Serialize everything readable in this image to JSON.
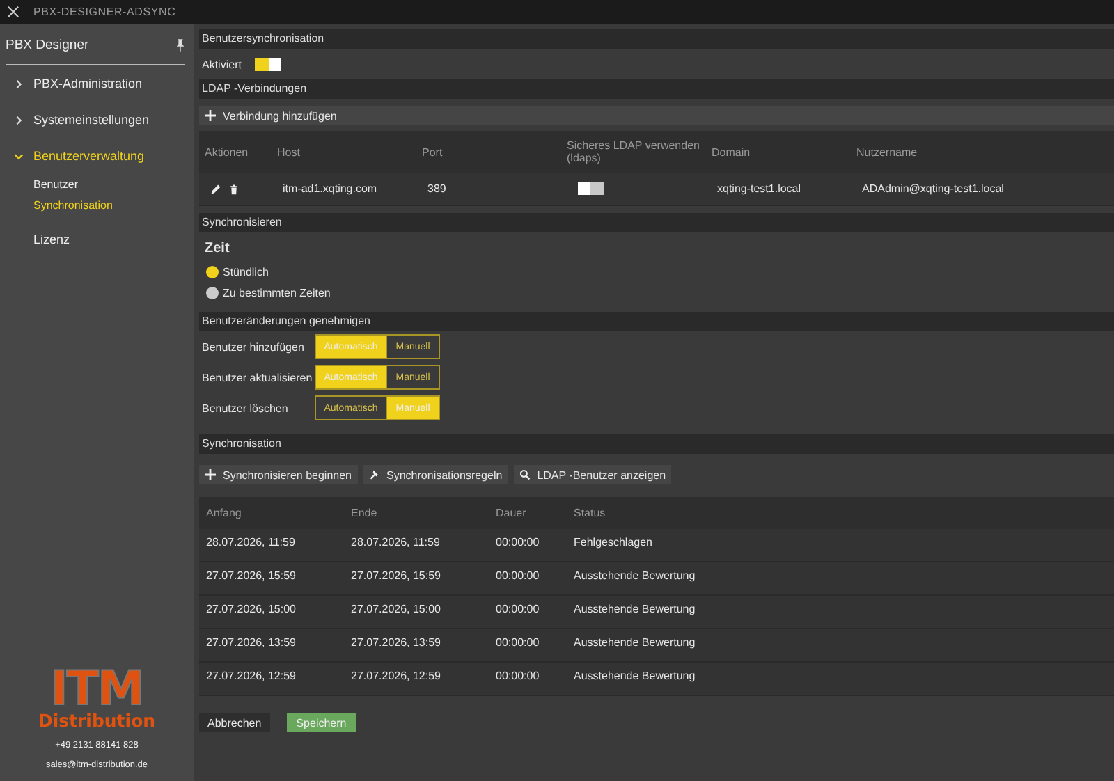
{
  "window": {
    "title": "PBX-DESIGNER-ADSYNC"
  },
  "sidebar": {
    "title": "PBX Designer",
    "items": [
      {
        "label": "PBX-Administration",
        "expanded": false,
        "selected": false
      },
      {
        "label": "Systemeinstellungen",
        "expanded": false,
        "selected": false
      },
      {
        "label": "Benutzerverwaltung",
        "expanded": true,
        "selected": true,
        "children": [
          {
            "label": "Benutzer",
            "selected": false
          },
          {
            "label": "Synchronisation",
            "selected": true
          }
        ]
      },
      {
        "label": "Lizenz",
        "selected": false
      }
    ],
    "logo": {
      "top": "ITM",
      "bottom": "Distribution"
    },
    "phone": "+49 2131 88141 828",
    "email": "sales@itm-distribution.de"
  },
  "user_sync": {
    "header": "Benutzersynchronisation",
    "label": "Aktiviert",
    "on": true
  },
  "ldap": {
    "header": "LDAP -Verbindungen",
    "add_button": "Verbindung hinzufügen",
    "columns": [
      "Aktionen",
      "Host",
      "Port",
      "Sicheres LDAP verwenden (ldaps)",
      "Domain",
      "Nutzername"
    ],
    "rows": [
      {
        "host": "itm-ad1.xqting.com",
        "port": "389",
        "ldaps": false,
        "domain": "xqting-test1.local",
        "user": "ADAdmin@xqting-test1.local"
      }
    ]
  },
  "schedule": {
    "header": "Synchronisieren",
    "title": "Zeit",
    "options": [
      {
        "label": "Stündlich",
        "selected": true
      },
      {
        "label": "Zu bestimmten Zeiten",
        "selected": false
      }
    ]
  },
  "approvals": {
    "header": "Benutzeränderungen genehmigen",
    "rows": [
      {
        "label": "Benutzer hinzufügen",
        "options": [
          {
            "label": "Automatisch",
            "selected": true
          },
          {
            "label": "Manuell",
            "selected": false
          }
        ]
      },
      {
        "label": "Benutzer aktualisieren",
        "options": [
          {
            "label": "Automatisch",
            "selected": true
          },
          {
            "label": "Manuell",
            "selected": false
          }
        ]
      },
      {
        "label": "Benutzer löschen",
        "options": [
          {
            "label": "Automatisch",
            "selected": false
          },
          {
            "label": "Manuell",
            "selected": true
          }
        ]
      }
    ]
  },
  "sync": {
    "header": "Synchronisation",
    "buttons": [
      {
        "label": "Synchronisieren beginnen",
        "kind": "plus"
      },
      {
        "label": "Synchronisationsregeln",
        "kind": "hammer"
      },
      {
        "label": "LDAP -Benutzer anzeigen",
        "kind": "search"
      }
    ],
    "columns": [
      "Anfang",
      "Ende",
      "Dauer",
      "Status"
    ],
    "rows": [
      [
        "28.07.2026, 11:59",
        "28.07.2026, 11:59",
        "00:00:00",
        "Fehlgeschlagen"
      ],
      [
        "27.07.2026, 15:59",
        "27.07.2026, 15:59",
        "00:00:00",
        "Ausstehende Bewertung"
      ],
      [
        "27.07.2026, 15:00",
        "27.07.2026, 15:00",
        "00:00:00",
        "Ausstehende Bewertung"
      ],
      [
        "27.07.2026, 13:59",
        "27.07.2026, 13:59",
        "00:00:00",
        "Ausstehende Bewertung"
      ],
      [
        "27.07.2026, 12:59",
        "27.07.2026, 12:59",
        "00:00:00",
        "Ausstehende Bewertung"
      ]
    ]
  },
  "footer": {
    "cancel": "Abbrechen",
    "save": "Speichern"
  }
}
